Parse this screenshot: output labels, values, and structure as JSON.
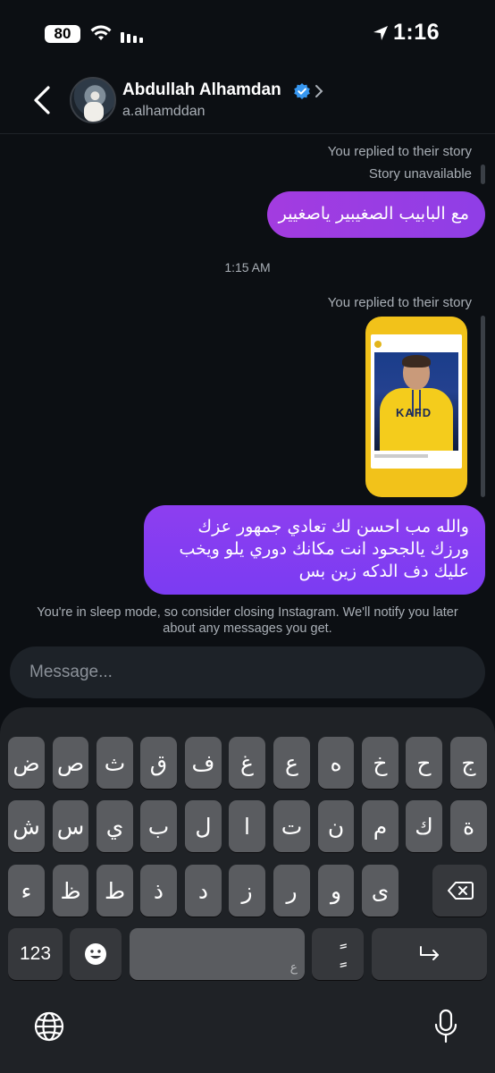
{
  "status_bar": {
    "battery": "80",
    "time": "1:16"
  },
  "header": {
    "name": "Abdullah Alhamdan",
    "username": "a.alhamddan"
  },
  "messages": {
    "replied_1": "You replied to their story",
    "story_unavailable": "Story unavailable",
    "bubble_1": "مع البابيب الصغيبير ياصغيير",
    "timestamp": "1:15 AM",
    "replied_2": "You replied to their story",
    "story_jersey_text": "KAFD",
    "bubble_2": "والله مب احسن لك تعادي جمهور عزك ورزك يالجحود انت مكانك دوري يلو ويخب عليك دف الدكه زين بس"
  },
  "sleep_notice": "You're in sleep mode, so consider closing Instagram. We'll notify you later about any messages you get.",
  "composer": {
    "placeholder": "Message..."
  },
  "keyboard": {
    "row1": [
      "ض",
      "ص",
      "ث",
      "ق",
      "ف",
      "غ",
      "ع",
      "ه",
      "خ",
      "ح",
      "ج"
    ],
    "row2": [
      "ش",
      "س",
      "ي",
      "ب",
      "ل",
      "ا",
      "ت",
      "ن",
      "م",
      "ك",
      "ة"
    ],
    "row3": [
      "ء",
      "ظ",
      "ط",
      "ذ",
      "د",
      "ز",
      "ر",
      "و",
      "ى"
    ],
    "num_key": "123",
    "space_hint": "ع",
    "tanween_key": "ًٍ"
  },
  "colors": {
    "bubble_pink": "#a33ce0",
    "bubble_purple": "#7b3cf2",
    "verified_blue": "#3797f0",
    "background": "#0c0f13"
  }
}
